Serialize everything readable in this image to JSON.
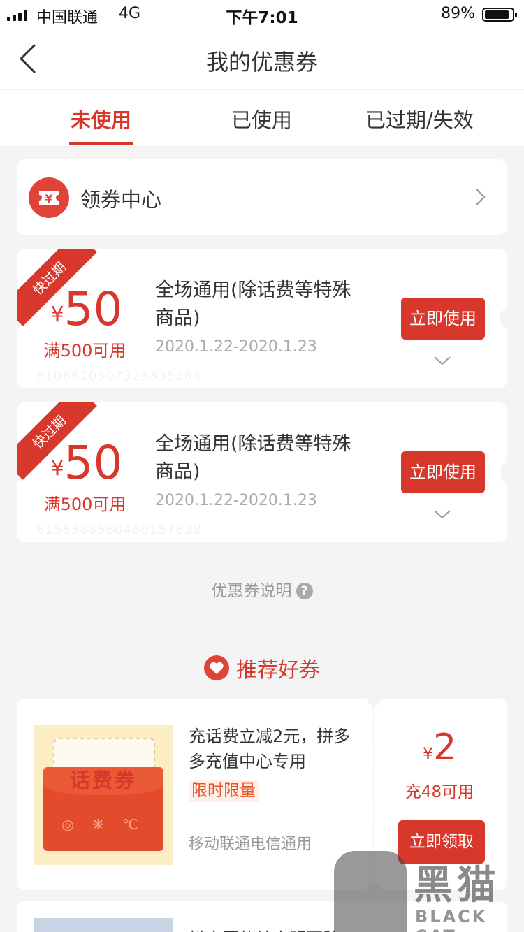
{
  "status_bar": {
    "carrier": "中国联通",
    "network": "4G",
    "time": "下午7:01",
    "battery": "89%",
    "battery_level": 0.89
  },
  "nav": {
    "title": "我的优惠券",
    "back_icon": "chevron-left-icon"
  },
  "tabs": [
    {
      "label": "未使用",
      "active": true
    },
    {
      "label": "已使用",
      "active": false
    },
    {
      "label": "已过期/失效",
      "active": false
    }
  ],
  "coupon_center": {
    "label": "领券中心",
    "icon_glyph": "¥"
  },
  "coupons": [
    {
      "badge": "快过期",
      "currency": "¥",
      "amount": "50",
      "condition": "满500可用",
      "title": "全场通用(除话费等特殊商品)",
      "date": "2020.1.22-2020.1.23",
      "button": "立即使用",
      "faint_id": "6106620507323335264"
    },
    {
      "badge": "快过期",
      "currency": "¥",
      "amount": "50",
      "condition": "满500可用",
      "title": "全场通用(除话费等特殊商品)",
      "date": "2020.1.22-2020.1.23",
      "button": "立即使用",
      "faint_id": "6158388560460157838"
    }
  ],
  "help": {
    "label": "优惠券说明",
    "icon_glyph": "?"
  },
  "recommend": {
    "title": "推荐好券",
    "items": [
      {
        "image_label": "话费券",
        "image_logos": "◎ ❋ ℃",
        "text": "充话费立减2元，拼多多充值中心专用",
        "tag": "限时限量",
        "subtext": "移动联通电信通用",
        "currency": "¥",
        "amount": "2",
        "condition": "充48可用",
        "button": "立即领取"
      },
      {
        "text": "抖音同款结尖明丽肤"
      }
    ]
  },
  "watermark": {
    "cn": "黑猫",
    "en": "BLACK CAT"
  },
  "colors": {
    "accent": "#d8372c",
    "background": "#f4f4f4"
  }
}
